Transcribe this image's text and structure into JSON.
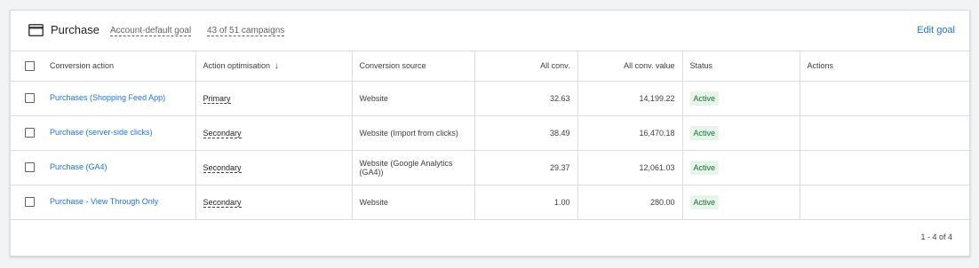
{
  "header": {
    "title": "Purchase",
    "goal_type": "Account-default goal",
    "campaigns": "43 of 51 campaigns",
    "edit_label": "Edit goal"
  },
  "table": {
    "columns": {
      "action": "Conversion action",
      "optimisation": "Action optimisation",
      "source": "Conversion source",
      "all_conv": "All conv.",
      "all_conv_value": "All conv. value",
      "status": "Status",
      "actions": "Actions"
    },
    "rows": [
      {
        "name": "Purchases (Shopping Feed App)",
        "optimisation": "Primary",
        "source": "Website",
        "all_conv": "32.63",
        "all_conv_value": "14,199.22",
        "status": "Active"
      },
      {
        "name": "Purchase (server-side clicks)",
        "optimisation": "Secondary",
        "source": "Website (Import from clicks)",
        "all_conv": "38.49",
        "all_conv_value": "16,470.18",
        "status": "Active"
      },
      {
        "name": "Purchase (GA4)",
        "optimisation": "Secondary",
        "source": "Website (Google Analytics (GA4))",
        "all_conv": "29.37",
        "all_conv_value": "12,061.03",
        "status": "Active"
      },
      {
        "name": "Purchase - View Through Only",
        "optimisation": "Secondary",
        "source": "Website",
        "all_conv": "1.00",
        "all_conv_value": "280.00",
        "status": "Active"
      }
    ]
  },
  "pagination": "1 - 4 of 4",
  "icons": {
    "header": "credit-card-icon",
    "sort": "arrow-down-icon"
  },
  "colors": {
    "link": "#1a73e8",
    "badge_bg": "#e6f4ea",
    "badge_text": "#137333"
  }
}
